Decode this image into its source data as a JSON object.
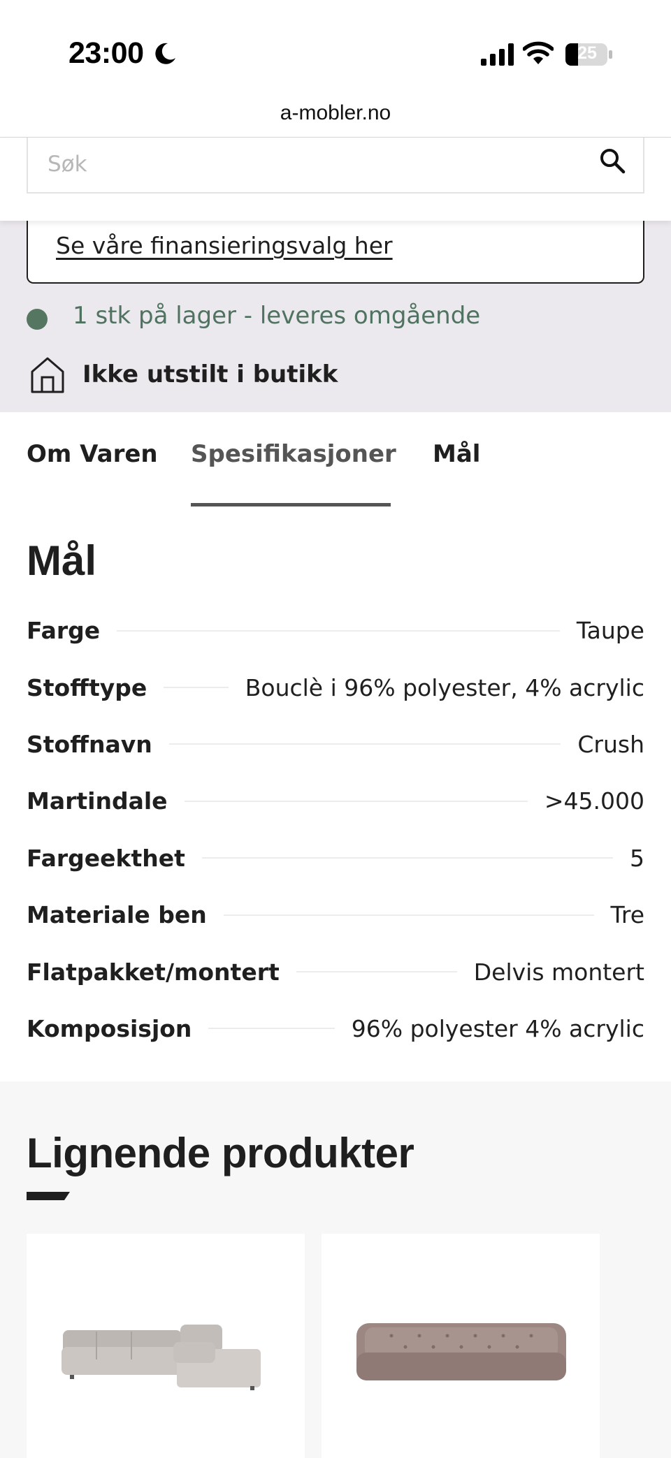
{
  "status_bar": {
    "time": "23:00",
    "battery_level": "25"
  },
  "browser": {
    "url": "a-mobler.no"
  },
  "search": {
    "placeholder": "Søk"
  },
  "info": {
    "financing_link": "Se våre finansieringsvalg her",
    "stock_status": "1 stk på lager - leveres omgående",
    "store_status": "Ikke utstilt i butikk",
    "stock_color": "#557761"
  },
  "tabs": [
    {
      "label": "Om Varen",
      "active": false
    },
    {
      "label": "Spesifikasjoner",
      "active": true
    },
    {
      "label": "Mål",
      "active": false
    }
  ],
  "specs": {
    "title": "Mål",
    "rows": [
      {
        "label": "Farge",
        "value": "Taupe"
      },
      {
        "label": "Stofftype",
        "value": "Bouclè i 96% polyester, 4% acrylic"
      },
      {
        "label": "Stoffnavn",
        "value": "Crush"
      },
      {
        "label": "Martindale",
        "value": ">45.000"
      },
      {
        "label": "Fargeekthet",
        "value": "5"
      },
      {
        "label": "Materiale ben",
        "value": "Tre"
      },
      {
        "label": "Flatpakket/montert",
        "value": "Delvis montert"
      },
      {
        "label": "Komposisjon",
        "value": "96% polyester 4% acrylic"
      }
    ]
  },
  "similar": {
    "title": "Lignende produkter",
    "products": [
      {
        "image": "corner-sofa-image",
        "color": "#c9c4c0"
      },
      {
        "image": "tufted-sofa-image",
        "color": "#a8948f"
      }
    ]
  }
}
